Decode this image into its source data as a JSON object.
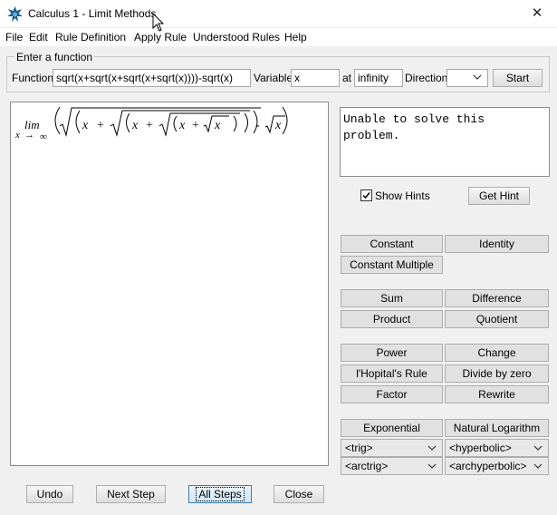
{
  "window": {
    "title": "Calculus 1 - Limit Methods",
    "close_glyph": "✕"
  },
  "menu": [
    "File",
    "Edit",
    "Rule Definition",
    "Apply Rule",
    "Understood Rules",
    "Help"
  ],
  "input_group": {
    "legend": "Enter a function",
    "function_label": "Function",
    "function_value": "sqrt(x+sqrt(x+sqrt(x+sqrt(x))))-sqrt(x)",
    "variable_label": "Variable",
    "variable_value": "x",
    "at_label": "at",
    "at_value": "infinity",
    "direction_label": "Direction",
    "direction_value": "",
    "start_label": "Start"
  },
  "math": {
    "lim": "lim",
    "sub_var": "x",
    "sub_arrow": "→",
    "sub_target": "∞",
    "x": "x",
    "plus": "+",
    "minus": "-"
  },
  "message": "Unable to solve this\nproblem.",
  "hints": {
    "show_label": "Show Hints",
    "checked": true,
    "get_hint_label": "Get Hint"
  },
  "rules": {
    "constant": "Constant",
    "identity": "Identity",
    "constant_multiple": "Constant Multiple",
    "sum": "Sum",
    "difference": "Difference",
    "product": "Product",
    "quotient": "Quotient",
    "power": "Power",
    "change": "Change",
    "lhopital": "l'Hopital's Rule",
    "divide_by_zero": "Divide by zero",
    "factor": "Factor",
    "rewrite": "Rewrite",
    "exponential": "Exponential",
    "natural_log": "Natural Logarithm"
  },
  "dropdowns": {
    "trig": "<trig>",
    "hyperbolic": "<hyperbolic>",
    "arctrig": "<arctrig>",
    "archyperbolic": "<archyperbolic>"
  },
  "bottom": {
    "undo": "Undo",
    "next_step": "Next Step",
    "all_steps": "All Steps",
    "close": "Close"
  },
  "icons": {
    "app": "app-logo-icon",
    "cursor": "mouse-cursor-icon",
    "check": "check-icon",
    "dropdown": "chevron-down-icon"
  }
}
